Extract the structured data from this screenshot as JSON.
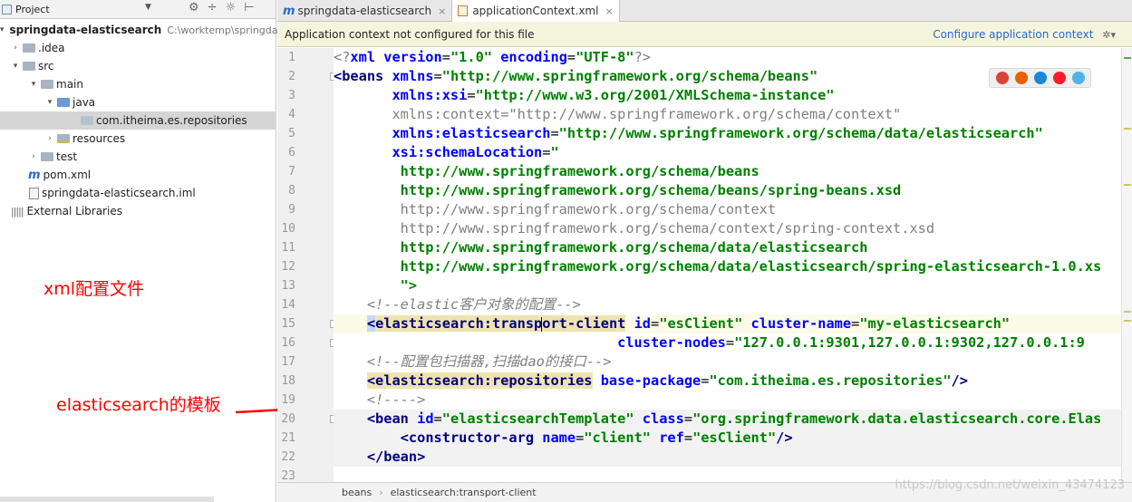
{
  "project_panel": {
    "title": "Project",
    "dropdown": "▼",
    "tools": [
      "⚙",
      "÷",
      "☼",
      "⊢"
    ],
    "tree": [
      {
        "label": "springdata-elasticsearch",
        "path": "C:\\worktemp\\springda",
        "expanded": true
      },
      {
        "label": ".idea"
      },
      {
        "label": "src",
        "expanded": true
      },
      {
        "label": "main",
        "expanded": true
      },
      {
        "label": "java",
        "expanded": true
      },
      {
        "label": "com.itheima.es.repositories",
        "selected": true
      },
      {
        "label": "resources"
      },
      {
        "label": "test"
      },
      {
        "label": "pom.xml"
      },
      {
        "label": "springdata-elasticsearch.iml"
      },
      {
        "label": "External Libraries"
      }
    ]
  },
  "annotations": {
    "xml_note": "xml配置文件",
    "es_note": "elasticsearch的模板"
  },
  "editor": {
    "tabs": [
      {
        "label": "springdata-elasticsearch",
        "close": "×",
        "active": false
      },
      {
        "label": "applicationContext.xml",
        "close": "×",
        "active": true
      }
    ],
    "banner": {
      "message": "Application context not configured for this file",
      "action": "Configure application context",
      "gear": "✲▾"
    },
    "line_numbers": [
      "1",
      "2",
      "3",
      "4",
      "5",
      "6",
      "7",
      "8",
      "9",
      "10",
      "11",
      "12",
      "13",
      "14",
      "15",
      "16",
      "17",
      "18",
      "19",
      "20",
      "21",
      "22",
      "23"
    ],
    "code": {
      "l1": [
        "<?",
        "xml version",
        "=",
        "\"1.0\"",
        " encoding",
        "=",
        "\"UTF-8\"",
        "?>"
      ],
      "l2": [
        "<beans ",
        "xmlns",
        "=",
        "\"http://www.springframework.org/schema/beans\""
      ],
      "l3": [
        "       xmlns:xsi",
        "=",
        "\"http://www.w3.org/2001/XMLSchema-instance\""
      ],
      "l4": "       xmlns:context=\"http://www.springframework.org/schema/context\"",
      "l5": [
        "       xmlns:elasticsearch",
        "=",
        "\"http://www.springframework.org/schema/data/elasticsearch\""
      ],
      "l6": [
        "       xsi:schemaLocation",
        "=",
        "\""
      ],
      "l7": "        http://www.springframework.org/schema/beans",
      "l8": "        http://www.springframework.org/schema/beans/spring-beans.xsd",
      "l9": "        http://www.springframework.org/schema/context",
      "l10": "        http://www.springframework.org/schema/context/spring-context.xsd",
      "l11": "        http://www.springframework.org/schema/data/elasticsearch",
      "l12": "        http://www.springframework.org/schema/data/elasticsearch/spring-elasticsearch-1.0.xs",
      "l13": "        \">",
      "l14": "    <!--elastic客户对象的配置-->",
      "l15": [
        "    ",
        "<",
        "elasticsearch:transp",
        "ort-client",
        " id",
        "=",
        "\"esClient\"",
        " cluster-name",
        "=",
        "\"my-elasticsearch\""
      ],
      "l16": [
        "                                  cluster-nodes",
        "=",
        "\"127.0.0.1:9301,127.0.0.1:9302,127.0.0.1:9"
      ],
      "l17": "    <!--配置包扫描器,扫描dao的接口-->",
      "l18": [
        "    ",
        "<elasticsearch:repositories",
        " base-package",
        "=",
        "\"com.itheima.es.repositories\"",
        "/>"
      ],
      "l19": "    <!---->",
      "l20": [
        "    ",
        "<bean ",
        "id",
        "=",
        "\"elasticsearchTemplate\"",
        " class",
        "=",
        "\"org.springframework.data.elasticsearch.core.Elas"
      ],
      "l21": [
        "        ",
        "<constructor-arg ",
        "name",
        "=",
        "\"client\"",
        " ref",
        "=",
        "\"esClient\"",
        "/>"
      ],
      "l22": [
        "    ",
        "</bean>"
      ],
      "l23": ""
    },
    "browser_icons": [
      "chrome-icon",
      "firefox-icon",
      "safari-icon",
      "opera-icon",
      "ie-icon"
    ],
    "breadcrumb": [
      "beans",
      "elasticsearch:transport-client"
    ],
    "watermark": "https://blog.csdn.net/weixin_43474123"
  },
  "colors": {
    "annotation_red": "#ff0000",
    "tag": "#000080",
    "attr": "#0000ff",
    "value": "#008000",
    "comment": "#808080"
  }
}
